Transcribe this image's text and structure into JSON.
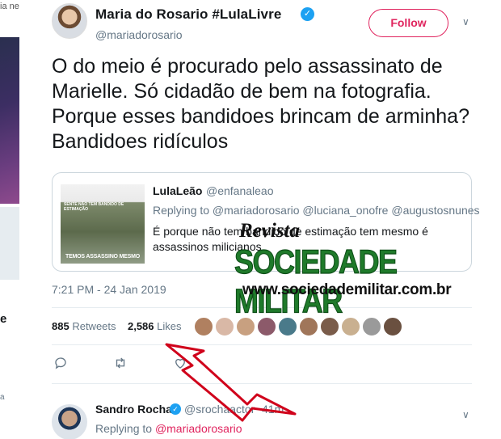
{
  "left_column": {
    "fragment_top": "ia ne",
    "fragment_mid": "e",
    "fragment_bottom": "a"
  },
  "tweet": {
    "author_name": "Maria do Rosario #LulaLivre",
    "author_handle": "@mariadorosario",
    "follow_label": "Follow",
    "text": "O do meio é procurado pelo assassinato de Marielle. Só cidadão de bem na fotografia. Porque esses bandidoes brincam de arminha? Bandidoes ridículos",
    "timestamp": "7:21 PM - 24 Jan 2019",
    "retweets_count": "885",
    "retweets_label": "Retweets",
    "likes_count": "2,586",
    "likes_label": "Likes"
  },
  "quoted_tweet": {
    "author_name": "LulaLeão",
    "author_handle": "@enfanaleao",
    "replying_to": "Replying to @mariadorosario @luciana_onofre @augustosnunes",
    "text": "É porque não tem bandido de estimação tem mesmo é assassinos milicianos",
    "image_caption_top": "SENTE NÃO TEM BANDIDO DE ESTIMAÇÃO",
    "image_caption_bottom": "TEMOS ASSASSINO MESMO"
  },
  "reply": {
    "author_name": "Sandro Rocha",
    "author_handle": "@srochaactor",
    "time": "41m",
    "replying_prefix": "Replying to",
    "replying_handle": "@mariadorosario"
  },
  "watermark": {
    "line1": "Revista",
    "line2": "SOCIEDADE MILITAR",
    "line3": "www.sociedademilitar.com.br"
  },
  "colors": {
    "follow_accent": "#e0245e",
    "verified_blue": "#1da1f2",
    "muted_text": "#657786",
    "watermark_green": "#1f7a2a",
    "arrow_red": "#d0021b"
  }
}
